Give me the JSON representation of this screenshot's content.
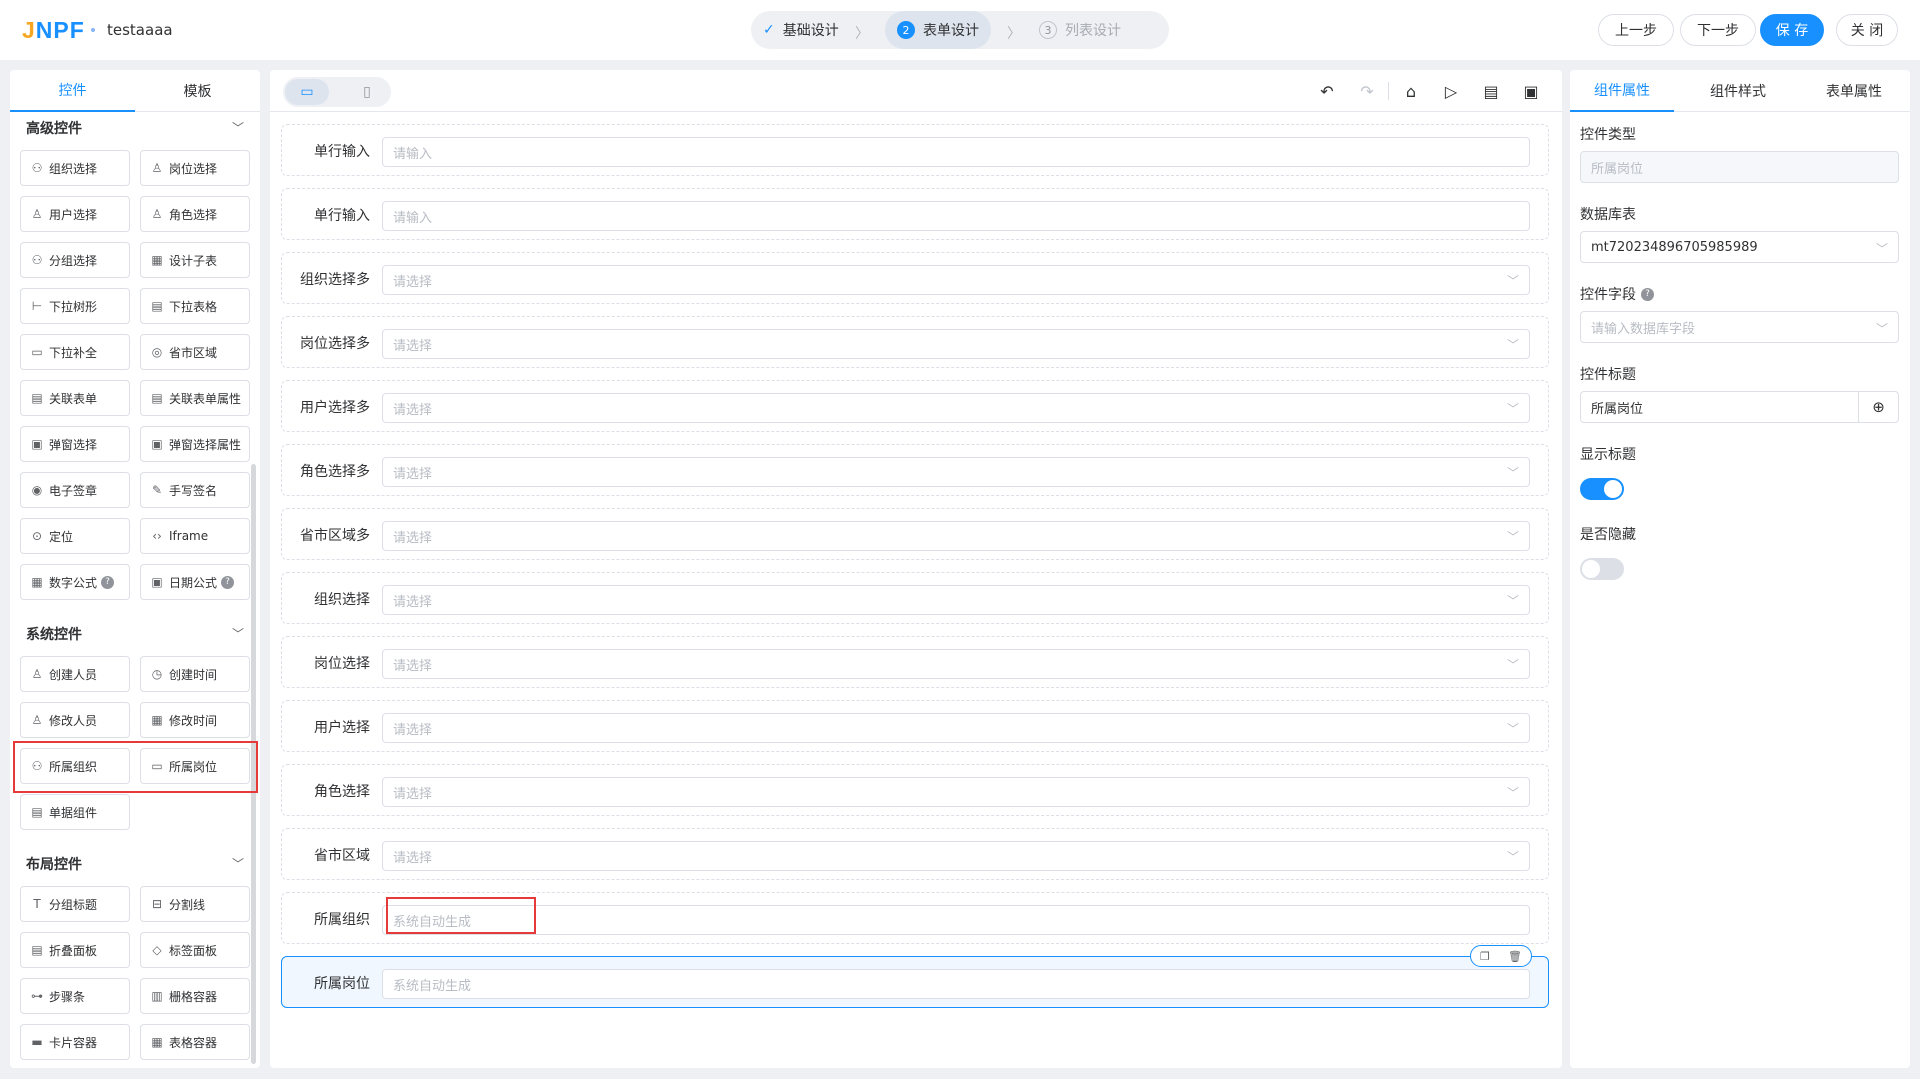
{
  "header": {
    "logo": "JNPF",
    "app_name": "testaaaa",
    "steps": [
      {
        "label": "基础设计",
        "num": "✓"
      },
      {
        "label": "表单设计",
        "num": "2"
      },
      {
        "label": "列表设计",
        "num": "3"
      }
    ],
    "buttons": {
      "prev": "上一步",
      "next": "下一步",
      "save": "保 存",
      "close": "关 闭"
    }
  },
  "left": {
    "tabs": [
      "控件",
      "模板"
    ],
    "groups": {
      "advanced": "高级控件",
      "system": "系统控件",
      "layout": "布局控件"
    },
    "advanced_items": [
      {
        "label": "组织选择",
        "icon": "org-icon"
      },
      {
        "label": "岗位选择",
        "icon": "post-icon"
      },
      {
        "label": "用户选择",
        "icon": "user-icon"
      },
      {
        "label": "角色选择",
        "icon": "role-icon"
      },
      {
        "label": "分组选择",
        "icon": "group-icon"
      },
      {
        "label": "设计子表",
        "icon": "table-icon"
      },
      {
        "label": "下拉树形",
        "icon": "tree-icon"
      },
      {
        "label": "下拉表格",
        "icon": "grid-icon"
      },
      {
        "label": "下拉补全",
        "icon": "autocomplete-icon"
      },
      {
        "label": "省市区域",
        "icon": "area-icon"
      },
      {
        "label": "关联表单",
        "icon": "form-icon"
      },
      {
        "label": "关联表单属性",
        "icon": "form-attr-icon"
      },
      {
        "label": "弹窗选择",
        "icon": "popup-icon"
      },
      {
        "label": "弹窗选择属性",
        "icon": "popup-attr-icon"
      },
      {
        "label": "电子签章",
        "icon": "seal-icon"
      },
      {
        "label": "手写签名",
        "icon": "sign-icon"
      },
      {
        "label": "定位",
        "icon": "location-icon"
      },
      {
        "label": "Iframe",
        "icon": "code-icon"
      },
      {
        "label": "数字公式",
        "icon": "calc-icon"
      },
      {
        "label": "日期公式",
        "icon": "date-formula-icon"
      }
    ],
    "system_items": [
      {
        "label": "创建人员",
        "icon": "user-icon"
      },
      {
        "label": "创建时间",
        "icon": "clock-icon"
      },
      {
        "label": "修改人员",
        "icon": "user-edit-icon"
      },
      {
        "label": "修改时间",
        "icon": "calendar-icon"
      },
      {
        "label": "所属组织",
        "icon": "org-icon"
      },
      {
        "label": "所属岗位",
        "icon": "post-icon"
      },
      {
        "label": "单据组件",
        "icon": "bill-icon"
      }
    ],
    "layout_items": [
      {
        "label": "分组标题",
        "icon": "title-icon"
      },
      {
        "label": "分割线",
        "icon": "divider-icon"
      },
      {
        "label": "折叠面板",
        "icon": "collapse-icon"
      },
      {
        "label": "标签面板",
        "icon": "tag-icon"
      },
      {
        "label": "步骤条",
        "icon": "steps-icon"
      },
      {
        "label": "栅格容器",
        "icon": "row-icon"
      },
      {
        "label": "卡片容器",
        "icon": "card-icon"
      },
      {
        "label": "表格容器",
        "icon": "table-icon"
      }
    ]
  },
  "canvas": {
    "rows": [
      {
        "label": "单行输入",
        "placeholder": "请输入",
        "select": false
      },
      {
        "label": "单行输入",
        "placeholder": "请输入",
        "select": false
      },
      {
        "label": "组织选择多",
        "placeholder": "请选择",
        "select": true
      },
      {
        "label": "岗位选择多",
        "placeholder": "请选择",
        "select": true
      },
      {
        "label": "用户选择多",
        "placeholder": "请选择",
        "select": true
      },
      {
        "label": "角色选择多",
        "placeholder": "请选择",
        "select": true
      },
      {
        "label": "省市区域多",
        "placeholder": "请选择",
        "select": true
      },
      {
        "label": "组织选择",
        "placeholder": "请选择",
        "select": true
      },
      {
        "label": "岗位选择",
        "placeholder": "请选择",
        "select": true
      },
      {
        "label": "用户选择",
        "placeholder": "请选择",
        "select": true
      },
      {
        "label": "角色选择",
        "placeholder": "请选择",
        "select": true
      },
      {
        "label": "省市区域",
        "placeholder": "请选择",
        "select": true
      },
      {
        "label": "所属组织",
        "placeholder": "系统自动生成",
        "select": false
      },
      {
        "label": "所属岗位",
        "placeholder": "系统自动生成",
        "select": false
      }
    ]
  },
  "right": {
    "tabs": [
      "组件属性",
      "组件样式",
      "表单属性"
    ],
    "control_type_label": "控件类型",
    "control_type_value": "所属岗位",
    "db_table_label": "数据库表",
    "db_table_value": "mt720234896705985989",
    "field_label": "控件字段",
    "field_placeholder": "请输入数据库字段",
    "title_label": "控件标题",
    "title_value": "所属岗位",
    "show_title_label": "显示标题",
    "show_title_on": true,
    "hidden_label": "是否隐藏",
    "hidden_on": false
  },
  "colors": {
    "accent": "#1890ff",
    "highlight": "#e5393a",
    "bg": "#eef0f4"
  }
}
